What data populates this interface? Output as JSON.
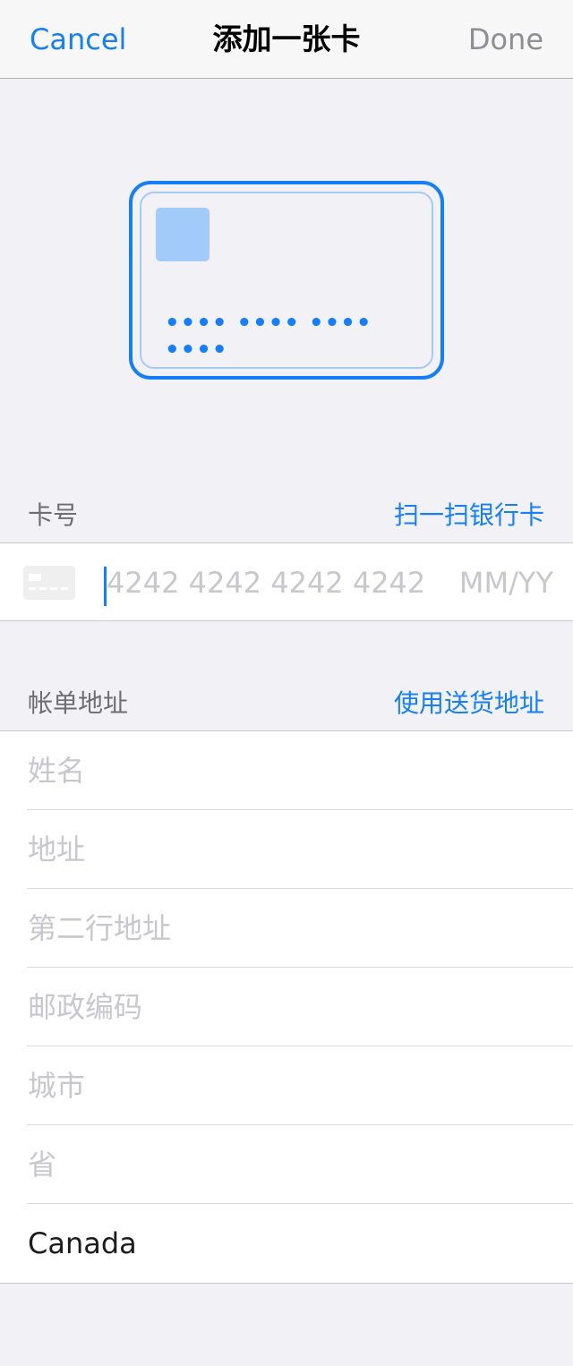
{
  "nav": {
    "cancel": "Cancel",
    "title": "添加一张卡",
    "done": "Done"
  },
  "card_preview": {
    "number_mask": "•••• •••• •••• ••••"
  },
  "card_section": {
    "label": "卡号",
    "action": "扫一扫银行卡",
    "number_placeholder": "4242 4242 4242 4242",
    "expiry_placeholder": "MM/YY"
  },
  "billing_section": {
    "label": "帐单地址",
    "action": "使用送货地址"
  },
  "address_fields": {
    "name_placeholder": "姓名",
    "address_placeholder": "地址",
    "address2_placeholder": "第二行地址",
    "postal_placeholder": "邮政编码",
    "city_placeholder": "城市",
    "province_placeholder": "省",
    "country_value": "Canada"
  },
  "colors": {
    "accent": "#147efb",
    "background": "#f2f2f6",
    "placeholder": "#c7c7cd"
  }
}
